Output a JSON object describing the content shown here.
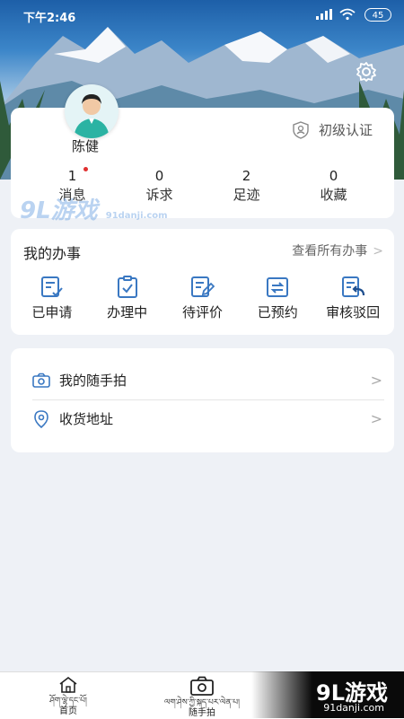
{
  "status_bar": {
    "time": "下午2:46",
    "battery": "45"
  },
  "profile": {
    "name": "陈健",
    "certification": "初级认证",
    "stats": [
      {
        "value": "1",
        "label": "消息",
        "has_dot": true
      },
      {
        "value": "0",
        "label": "诉求"
      },
      {
        "value": "2",
        "label": "足迹"
      },
      {
        "value": "0",
        "label": "收藏"
      }
    ]
  },
  "affairs": {
    "title": "我的办事",
    "view_all": "查看所有办事",
    "actions": [
      {
        "label": "已申请",
        "icon": "applied-icon"
      },
      {
        "label": "办理中",
        "icon": "processing-icon"
      },
      {
        "label": "待评价",
        "icon": "pending-review-icon"
      },
      {
        "label": "已预约",
        "icon": "reserved-icon"
      },
      {
        "label": "审核驳回",
        "icon": "rejected-icon"
      }
    ]
  },
  "links": [
    {
      "label": "我的随手拍",
      "icon": "camera-icon"
    },
    {
      "label": "收货地址",
      "icon": "location-icon"
    }
  ],
  "tabbar": [
    {
      "tibetan": "ཤོག་ལྷེ་དང་པོ།",
      "label": "首页",
      "icon": "home-icon"
    },
    {
      "tibetan": "ལག་ཤེས་ཀྱི་སྐད་པར་ལེན་པ།",
      "label": "随手拍",
      "icon": "camera-icon"
    }
  ],
  "watermark": {
    "text": "9L游戏",
    "url": "91danji.com",
    "overlay_text": "9L游戏",
    "overlay_url": "91danji.com"
  },
  "colors": {
    "accent": "#2a6fb5",
    "icon_blue": "#3a78c2",
    "dot": "#e03030"
  }
}
